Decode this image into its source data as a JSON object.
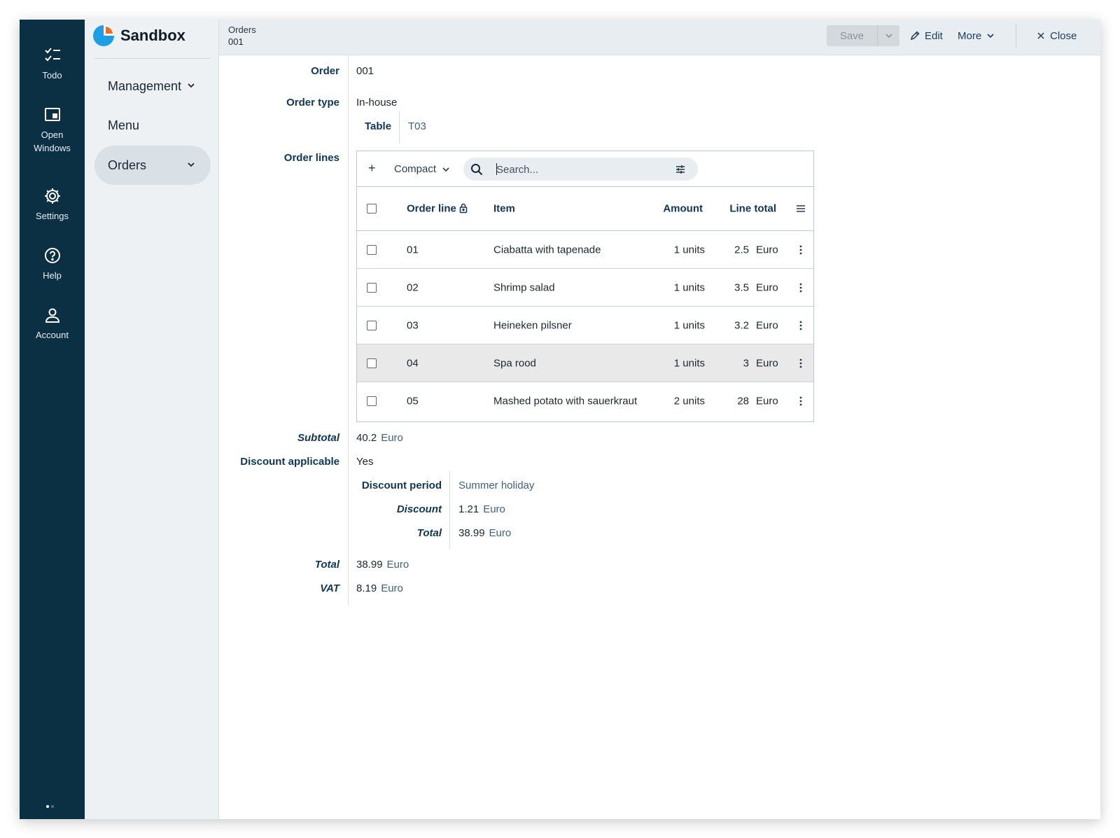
{
  "rail": {
    "items": [
      {
        "label": "Todo",
        "icon": "todo-checklist-icon"
      },
      {
        "label": "Open Windows",
        "icon": "window-icon"
      },
      {
        "label": "Settings",
        "icon": "gear-icon"
      },
      {
        "label": "Help",
        "icon": "help-circle-icon"
      },
      {
        "label": "Account",
        "icon": "user-icon"
      }
    ]
  },
  "brand": {
    "name": "Sandbox",
    "colors": {
      "primary": "#1ba0e8",
      "accent": "#f26b1d"
    }
  },
  "nav": {
    "items": [
      {
        "label": "Management",
        "expandable": true,
        "active": false
      },
      {
        "label": "Menu",
        "expandable": false,
        "active": false
      },
      {
        "label": "Orders",
        "expandable": true,
        "active": true
      }
    ]
  },
  "header": {
    "breadcrumb_parent": "Orders",
    "breadcrumb_current": "001",
    "save_label": "Save",
    "edit_label": "Edit",
    "more_label": "More",
    "close_label": "Close"
  },
  "form": {
    "order_label": "Order",
    "order_value": "001",
    "order_type_label": "Order type",
    "order_type_value": "In-house",
    "table_label": "Table",
    "table_value": "T03",
    "order_lines_label": "Order lines",
    "subtotal_label": "Subtotal",
    "subtotal_value": "40.2",
    "subtotal_unit": "Euro",
    "discount_applicable_label": "Discount applicable",
    "discount_applicable_value": "Yes",
    "discount_period_label": "Discount period",
    "discount_period_value": "Summer holiday",
    "discount_label": "Discount",
    "discount_value": "1.21",
    "discount_unit": "Euro",
    "inner_total_label": "Total",
    "inner_total_value": "38.99",
    "inner_total_unit": "Euro",
    "total_label": "Total",
    "total_value": "38.99",
    "total_unit": "Euro",
    "vat_label": "VAT",
    "vat_value": "8.19",
    "vat_unit": "Euro"
  },
  "order_lines": {
    "add_label": "+",
    "view_label": "Compact",
    "search_placeholder": "Search...",
    "columns": {
      "line": "Order line",
      "item": "Item",
      "amount": "Amount",
      "total": "Line total"
    },
    "rows": [
      {
        "line": "01",
        "item": "Ciabatta with tapenade",
        "amount": "1 units",
        "total": "2.5",
        "unit": "Euro"
      },
      {
        "line": "02",
        "item": "Shrimp salad",
        "amount": "1 units",
        "total": "3.5",
        "unit": "Euro"
      },
      {
        "line": "03",
        "item": "Heineken pilsner",
        "amount": "1 units",
        "total": "3.2",
        "unit": "Euro"
      },
      {
        "line": "04",
        "item": "Spa rood",
        "amount": "1 units",
        "total": "3",
        "unit": "Euro",
        "highlighted": true
      },
      {
        "line": "05",
        "item": "Mashed potato with sauerkraut",
        "amount": "2 units",
        "total": "28",
        "unit": "Euro"
      }
    ]
  }
}
